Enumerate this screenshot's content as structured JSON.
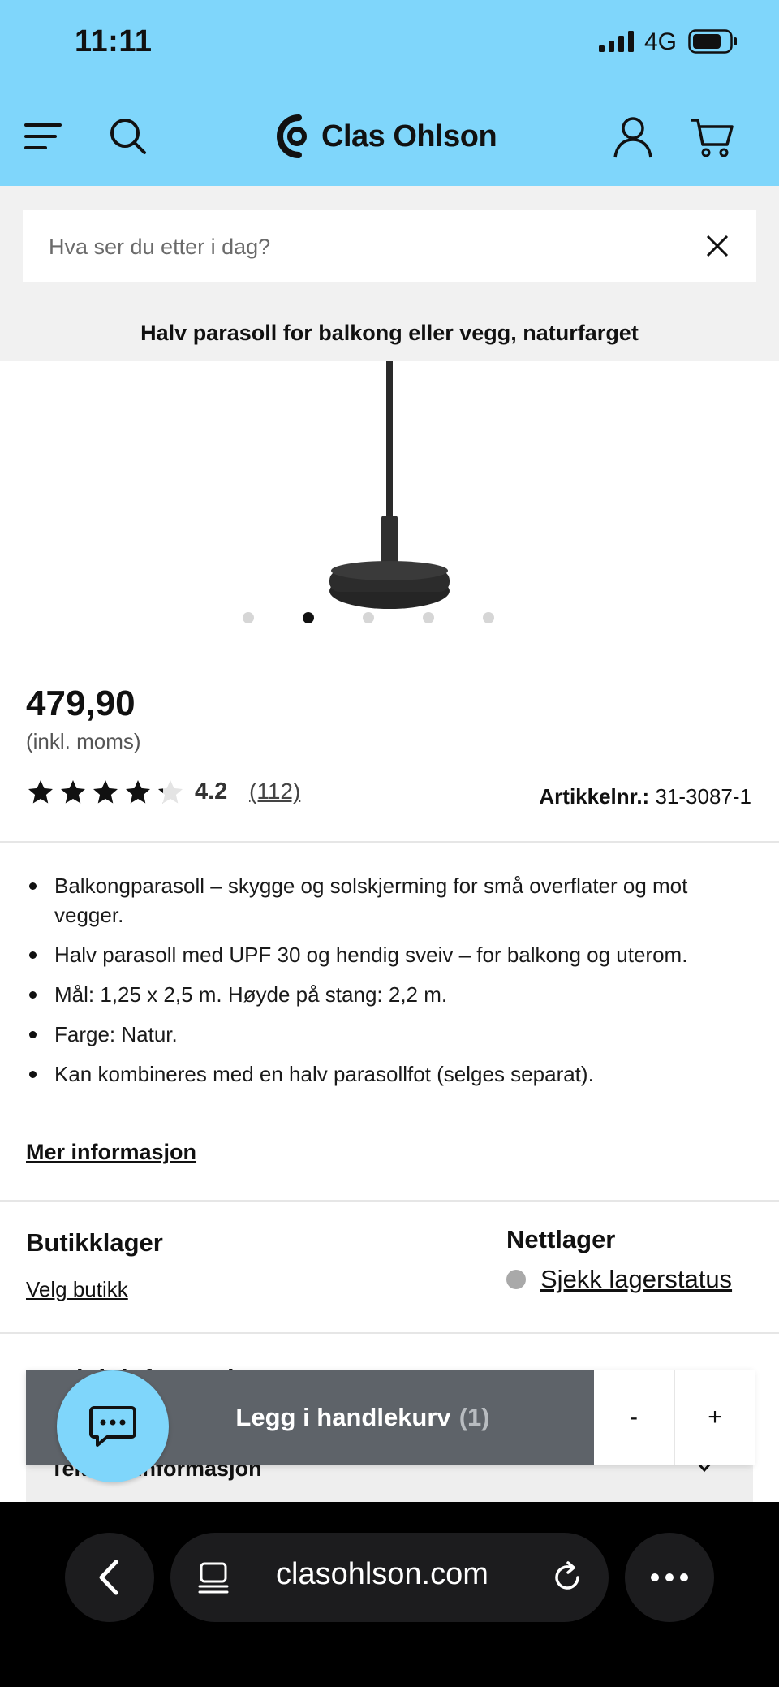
{
  "status_bar": {
    "time": "11:11",
    "network": "4G"
  },
  "header": {
    "brand": "Clas Ohlson",
    "icons": [
      "menu-icon",
      "search-icon",
      "account-icon",
      "cart-icon"
    ]
  },
  "search": {
    "placeholder": "Hva ser du etter i dag?"
  },
  "product": {
    "title": "Halv parasoll for balkong eller vegg, naturfarget",
    "image_dots": 5,
    "active_dot": 2,
    "price": "479,90",
    "vat_note": "(inkl. moms)",
    "rating_value": 4.2,
    "rating_text": "4.2",
    "review_count_text": "(112)",
    "article_label": "Artikkelnr.:",
    "article_number": "31-3087-1",
    "bullets": [
      "Balkongparasoll – skygge og solskjerming for små overflater og mot vegger.",
      "Halv parasoll med UPF 30 og hendig sveiv – for balkong og uterom.",
      "Mål: 1,25 x 2,5 m. Høyde på stang: 2,2 m.",
      "Farge: Natur.",
      "Kan kombineres med en halv parasollfot (selges separat)."
    ],
    "more_info": "Mer informasjon"
  },
  "stock": {
    "store_title": "Butikklager",
    "store_link": "Velg butikk",
    "online_title": "Nettlager",
    "online_link": "Sjekk lagerstatus"
  },
  "accordion": {
    "peek_title": "Produktinformasjon",
    "item_label": "Teknisk informasjon"
  },
  "cart": {
    "button_label": "Legg i handlekurv",
    "count": "(1)",
    "minus": "-",
    "plus": "+"
  },
  "browser": {
    "url": "clasohlson.com"
  },
  "colors": {
    "brand_bg": "#7fd6fb",
    "cart_button": "#5e6369",
    "page_bg": "#ffffff",
    "strip_bg": "#f1f1f1"
  }
}
